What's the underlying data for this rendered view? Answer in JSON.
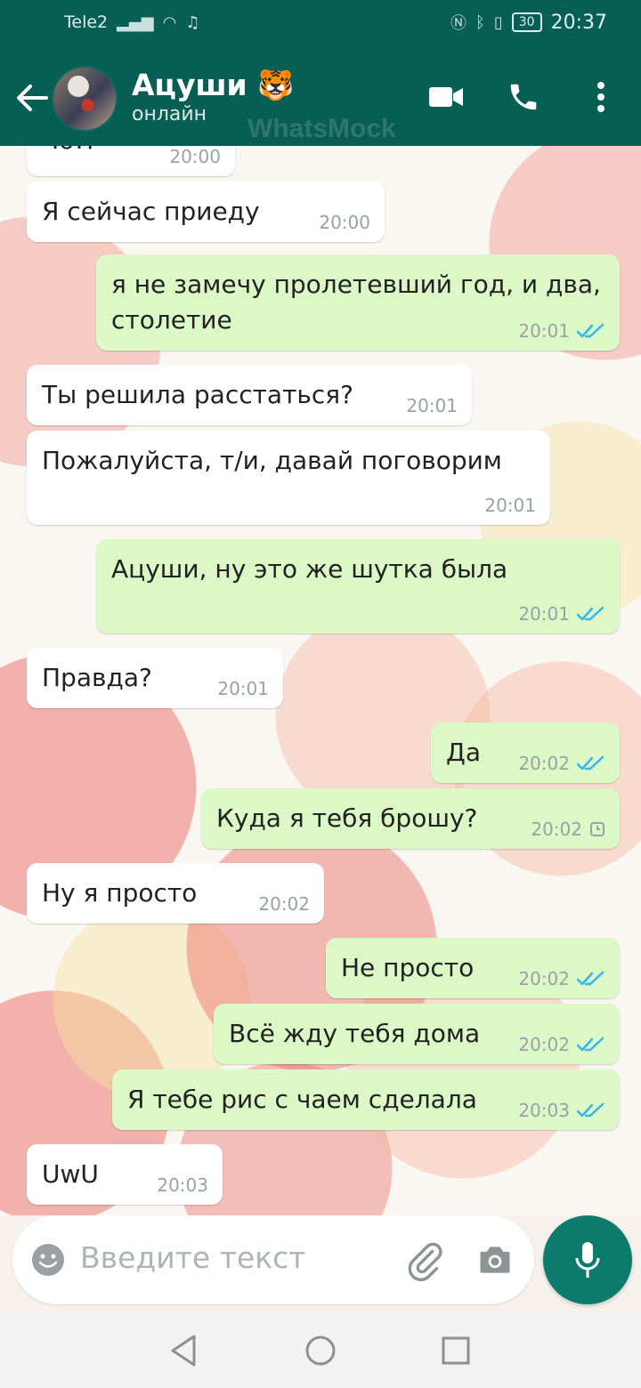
{
  "status_bar": {
    "carrier": "Tele2",
    "battery": "30",
    "time": "20:37"
  },
  "header": {
    "name": "Ацуши 🐯",
    "status": "онлайн",
    "watermark": "WhatsMock"
  },
  "input": {
    "placeholder": "Введите текст"
  },
  "messages": [
    {
      "dir": "in",
      "text": "Чо!?",
      "time": "20:00"
    },
    {
      "dir": "in",
      "text": "Я сейчас приеду",
      "time": "20:00"
    },
    {
      "dir": "out",
      "text": "я не замечу пролетевший год, и два,\nстолетие",
      "time": "20:01",
      "status": "read"
    },
    {
      "dir": "in",
      "text": "Ты решила расстаться?",
      "time": "20:01"
    },
    {
      "dir": "in",
      "text": "Пожалуйста, т/и, давай поговорим",
      "time": "20:01"
    },
    {
      "dir": "out",
      "text": "Ацуши, ну это же шутка была",
      "time": "20:01",
      "status": "read"
    },
    {
      "dir": "in",
      "text": "Правда?",
      "time": "20:01"
    },
    {
      "dir": "out",
      "text": "Да",
      "time": "20:02",
      "status": "read"
    },
    {
      "dir": "out",
      "text": "Куда я тебя брошу?",
      "time": "20:02",
      "status": "pending"
    },
    {
      "dir": "in",
      "text": "Ну я просто",
      "time": "20:02"
    },
    {
      "dir": "out",
      "text": "Не просто",
      "time": "20:02",
      "status": "read"
    },
    {
      "dir": "out",
      "text": "Всё жду тебя дома",
      "time": "20:02",
      "status": "read"
    },
    {
      "dir": "out",
      "text": "Я тебе рис с чаем сделала",
      "time": "20:03",
      "status": "read"
    },
    {
      "dir": "in",
      "text": "UwU",
      "time": "20:03"
    }
  ],
  "colors": {
    "header": "#075e54",
    "outgoing_bubble": "#dcf8c6",
    "incoming_bubble": "#ffffff",
    "read_tick": "#34b7f1",
    "mic_button": "#0b7b6d"
  }
}
